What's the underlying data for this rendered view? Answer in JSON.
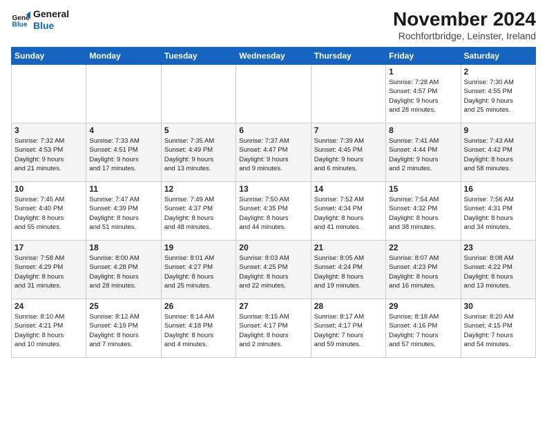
{
  "logo": {
    "line1": "General",
    "line2": "Blue"
  },
  "title": "November 2024",
  "location": "Rochfortbridge, Leinster, Ireland",
  "weekdays": [
    "Sunday",
    "Monday",
    "Tuesday",
    "Wednesday",
    "Thursday",
    "Friday",
    "Saturday"
  ],
  "weeks": [
    [
      {
        "day": "",
        "info": ""
      },
      {
        "day": "",
        "info": ""
      },
      {
        "day": "",
        "info": ""
      },
      {
        "day": "",
        "info": ""
      },
      {
        "day": "",
        "info": ""
      },
      {
        "day": "1",
        "info": "Sunrise: 7:28 AM\nSunset: 4:57 PM\nDaylight: 9 hours\nand 28 minutes."
      },
      {
        "day": "2",
        "info": "Sunrise: 7:30 AM\nSunset: 4:55 PM\nDaylight: 9 hours\nand 25 minutes."
      }
    ],
    [
      {
        "day": "3",
        "info": "Sunrise: 7:32 AM\nSunset: 4:53 PM\nDaylight: 9 hours\nand 21 minutes."
      },
      {
        "day": "4",
        "info": "Sunrise: 7:33 AM\nSunset: 4:51 PM\nDaylight: 9 hours\nand 17 minutes."
      },
      {
        "day": "5",
        "info": "Sunrise: 7:35 AM\nSunset: 4:49 PM\nDaylight: 9 hours\nand 13 minutes."
      },
      {
        "day": "6",
        "info": "Sunrise: 7:37 AM\nSunset: 4:47 PM\nDaylight: 9 hours\nand 9 minutes."
      },
      {
        "day": "7",
        "info": "Sunrise: 7:39 AM\nSunset: 4:45 PM\nDaylight: 9 hours\nand 6 minutes."
      },
      {
        "day": "8",
        "info": "Sunrise: 7:41 AM\nSunset: 4:44 PM\nDaylight: 9 hours\nand 2 minutes."
      },
      {
        "day": "9",
        "info": "Sunrise: 7:43 AM\nSunset: 4:42 PM\nDaylight: 8 hours\nand 58 minutes."
      }
    ],
    [
      {
        "day": "10",
        "info": "Sunrise: 7:45 AM\nSunset: 4:40 PM\nDaylight: 8 hours\nand 55 minutes."
      },
      {
        "day": "11",
        "info": "Sunrise: 7:47 AM\nSunset: 4:39 PM\nDaylight: 8 hours\nand 51 minutes."
      },
      {
        "day": "12",
        "info": "Sunrise: 7:49 AM\nSunset: 4:37 PM\nDaylight: 8 hours\nand 48 minutes."
      },
      {
        "day": "13",
        "info": "Sunrise: 7:50 AM\nSunset: 4:35 PM\nDaylight: 8 hours\nand 44 minutes."
      },
      {
        "day": "14",
        "info": "Sunrise: 7:52 AM\nSunset: 4:34 PM\nDaylight: 8 hours\nand 41 minutes."
      },
      {
        "day": "15",
        "info": "Sunrise: 7:54 AM\nSunset: 4:32 PM\nDaylight: 8 hours\nand 38 minutes."
      },
      {
        "day": "16",
        "info": "Sunrise: 7:56 AM\nSunset: 4:31 PM\nDaylight: 8 hours\nand 34 minutes."
      }
    ],
    [
      {
        "day": "17",
        "info": "Sunrise: 7:58 AM\nSunset: 4:29 PM\nDaylight: 8 hours\nand 31 minutes."
      },
      {
        "day": "18",
        "info": "Sunrise: 8:00 AM\nSunset: 4:28 PM\nDaylight: 8 hours\nand 28 minutes."
      },
      {
        "day": "19",
        "info": "Sunrise: 8:01 AM\nSunset: 4:27 PM\nDaylight: 8 hours\nand 25 minutes."
      },
      {
        "day": "20",
        "info": "Sunrise: 8:03 AM\nSunset: 4:25 PM\nDaylight: 8 hours\nand 22 minutes."
      },
      {
        "day": "21",
        "info": "Sunrise: 8:05 AM\nSunset: 4:24 PM\nDaylight: 8 hours\nand 19 minutes."
      },
      {
        "day": "22",
        "info": "Sunrise: 8:07 AM\nSunset: 4:23 PM\nDaylight: 8 hours\nand 16 minutes."
      },
      {
        "day": "23",
        "info": "Sunrise: 8:08 AM\nSunset: 4:22 PM\nDaylight: 8 hours\nand 13 minutes."
      }
    ],
    [
      {
        "day": "24",
        "info": "Sunrise: 8:10 AM\nSunset: 4:21 PM\nDaylight: 8 hours\nand 10 minutes."
      },
      {
        "day": "25",
        "info": "Sunrise: 8:12 AM\nSunset: 4:19 PM\nDaylight: 8 hours\nand 7 minutes."
      },
      {
        "day": "26",
        "info": "Sunrise: 8:14 AM\nSunset: 4:18 PM\nDaylight: 8 hours\nand 4 minutes."
      },
      {
        "day": "27",
        "info": "Sunrise: 8:15 AM\nSunset: 4:17 PM\nDaylight: 8 hours\nand 2 minutes."
      },
      {
        "day": "28",
        "info": "Sunrise: 8:17 AM\nSunset: 4:17 PM\nDaylight: 7 hours\nand 59 minutes."
      },
      {
        "day": "29",
        "info": "Sunrise: 8:18 AM\nSunset: 4:16 PM\nDaylight: 7 hours\nand 57 minutes."
      },
      {
        "day": "30",
        "info": "Sunrise: 8:20 AM\nSunset: 4:15 PM\nDaylight: 7 hours\nand 54 minutes."
      }
    ]
  ]
}
